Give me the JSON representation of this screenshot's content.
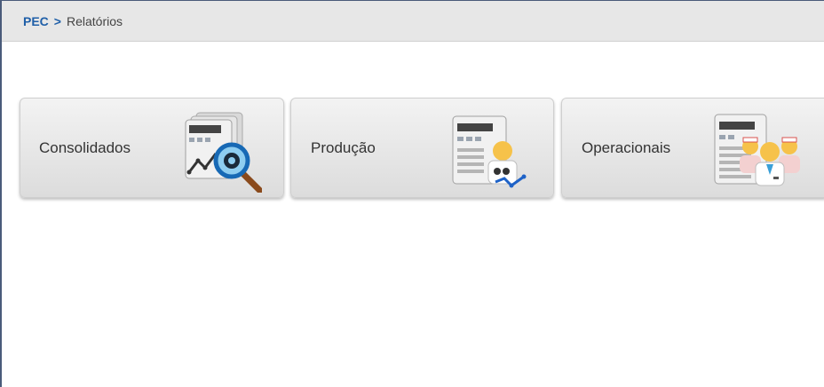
{
  "breadcrumb": {
    "root": "PEC",
    "separator": ">",
    "current": "Relatórios"
  },
  "cards": [
    {
      "label": "Consolidados",
      "icon": "report-magnifier-icon"
    },
    {
      "label": "Produção",
      "icon": "report-production-icon"
    },
    {
      "label": "Operacionais",
      "icon": "report-team-icon"
    }
  ],
  "colors": {
    "breadcrumb_link": "#1f5fa8",
    "card_bg": "#e6e6e6"
  }
}
